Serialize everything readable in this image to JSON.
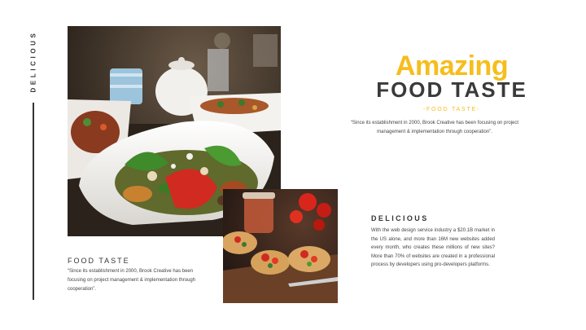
{
  "side": {
    "label": "DELICIOUS"
  },
  "title": {
    "amazing": "Amazing",
    "food_taste": "FOOD TASTE",
    "subtitle": "-FOOD TASTE-",
    "quote": "“Since its establishment in 2000, Brook Creative has been focusing on project management & implementation through cooperation”."
  },
  "delicious": {
    "heading": "DELICIOUS",
    "body": "With the web design service industry a $20.1B market in the US alone, and more than 16M new websites added every month, who creates these millions of new sites? More than 70% of websites are created in a professional process by developers using pro-developers platforms."
  },
  "food_taste": {
    "heading": "FOOD TASTE",
    "body": "“Since its establishment in 2000, Brook Creative has been focusing on project management & implementation through cooperation”."
  },
  "images": {
    "main": "salad-bowl-restaurant-table-photo",
    "secondary": "bruschetta-tomato-toast-photo"
  },
  "colors": {
    "accent": "#f6bd1d",
    "dark_text": "#3a3a3a",
    "body_text": "#444444",
    "background": "#ffffff"
  }
}
